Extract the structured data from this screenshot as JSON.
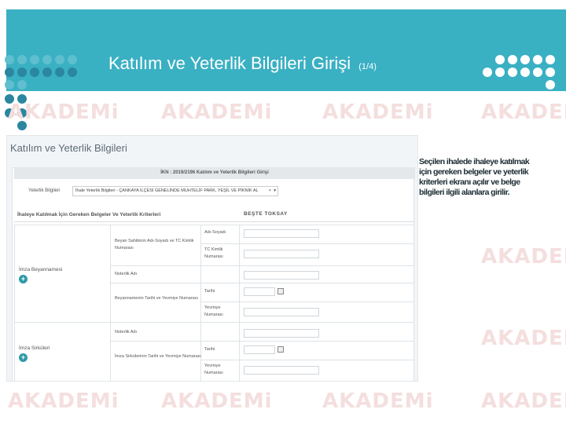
{
  "slide": {
    "title": "Katılım ve Yeterlik Bilgileri Girişi",
    "page": "(1/4)",
    "banner_color": "#3ab0c3",
    "dot_color": "#2b86a0",
    "watermark": "AKADEMi",
    "watermark_tag": "ekap"
  },
  "panel": {
    "title": "Katılım ve Yeterlik Bilgileri",
    "ikn_header": "İKN : 2019/2196 Katılım ve Yeterlik Bilgileri Girişi",
    "yeterlik_label": "Yeterlik Bilgileri",
    "select_value": "İhale Yeterlik Bilgileri - ÇANKAYA İLÇESİ GENELİNDE MUHTELİF PARK, YEŞİL VE PİKNİK AL",
    "select_clear": "×",
    "select_caret": "▾",
    "section_title": "İhaleye Katılmak İçin Gereken Belgeler Ve Yeterlik Kriterleri",
    "overlap_text": "BEŞTE TOKSAY"
  },
  "groups": [
    {
      "label": "İmza Beyannamesi",
      "rows": [
        {
          "name": "Beyan Sahibinin Adı-Soyadı ve TC Kimlik Numarası",
          "fields": [
            "Adı-Soyadı",
            "TC Kimlik Numarası"
          ]
        },
        {
          "name": "Noterlik Adı",
          "fields": []
        },
        {
          "name": "Beyannamenin Tarihi ve Yevmiye Numarası",
          "fields": [
            "Tarihi",
            "Yevmiye Numarası"
          ]
        }
      ]
    },
    {
      "label": "İmza Sirküleri",
      "rows": [
        {
          "name": "Noterlik Adı",
          "fields": []
        },
        {
          "name": "İmza Sirkülerinin Tarihi ve Yevmiye Numarası",
          "fields": [
            "Tarihi",
            "Yevmiye Numarası"
          ]
        }
      ]
    }
  ],
  "add_icon": "plus-icon",
  "note": "Seçilen ihalede ihaleye katılmak için gereken belgeler ve yeterlik kriterleri ekranı açılır ve belge bilgileri ilgili alanlara girilir."
}
